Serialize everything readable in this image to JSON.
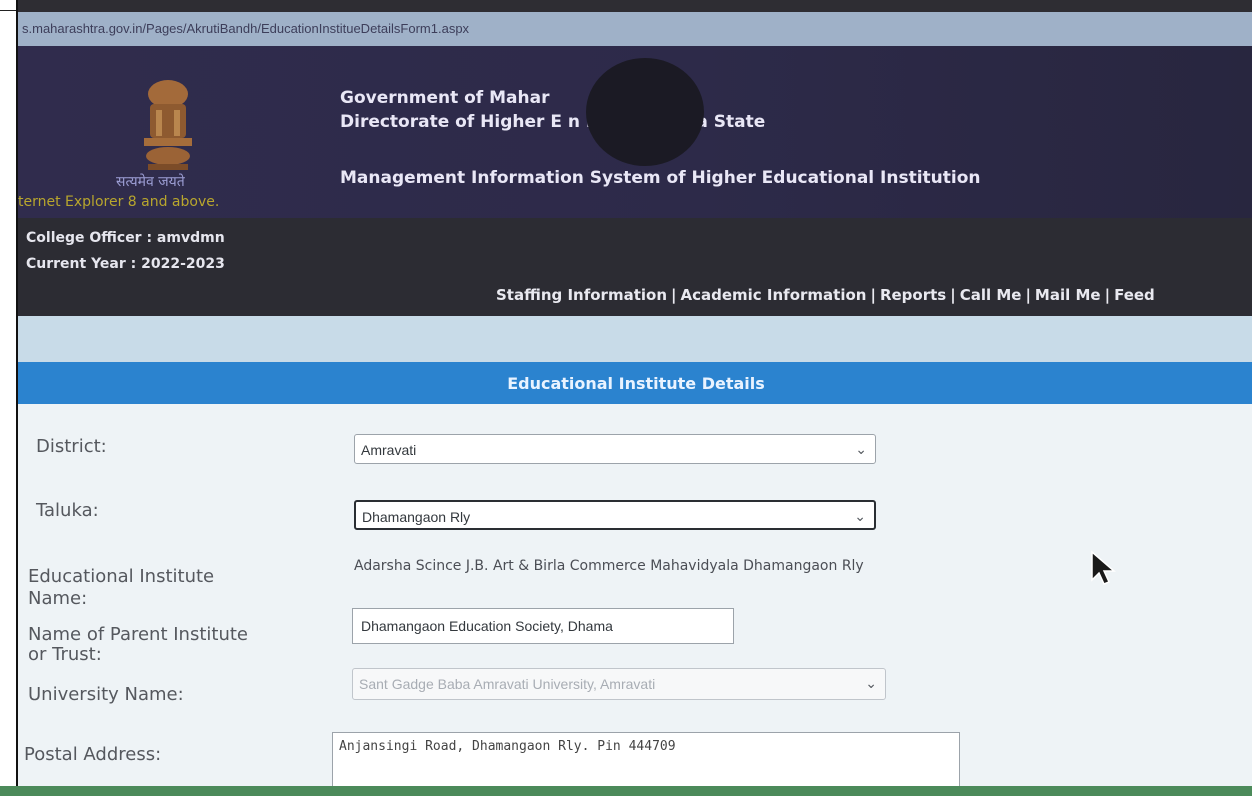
{
  "browser": {
    "address_text": "s.maharashtra.gov.in/Pages/AkrutiBandh/EducationInstitueDetailsForm1.aspx"
  },
  "header": {
    "motto": "सत्यमेव जयते",
    "ie_note": "ternet Explorer 8 and above.",
    "title_line1": "Government of Mahar",
    "title_line2": "Directorate of Higher E        n Maharashtra State",
    "title_line3": "Management Information System of Higher Educational Institution",
    "emblem_icon": "national-emblem-icon"
  },
  "user": {
    "officer": "College Officer : amvdmn",
    "year": "Current Year : 2022-2023"
  },
  "nav": {
    "items": [
      "Staffing Information",
      "Academic Information",
      "Reports",
      "Call Me",
      "Mail Me",
      "Feed"
    ],
    "separator": "|"
  },
  "section": {
    "title": "Educational Institute Details"
  },
  "form": {
    "district_label": "District:",
    "district_value": "Amravati",
    "taluka_label": "Taluka:",
    "taluka_value": "Dhamangaon Rly",
    "institute_label_line1": "Educational Institute",
    "institute_label_line2": "Name:",
    "institute_value": "Adarsha Scince J.B. Art & Birla Commerce Mahavidyala Dhamangaon Rly",
    "parent_label_line1": "Name of Parent Institute",
    "parent_label_line2": "or Trust:",
    "parent_value": "Dhamangaon Education Society, Dhama",
    "university_label": "University Name:",
    "university_value": "Sant Gadge Baba Amravati University, Amravati",
    "postal_label": "Postal Address:",
    "postal_value": "Anjansingi Road, Dhamangaon Rly. Pin 444709"
  },
  "colors": {
    "banner": "#2d2a49",
    "section_bar": "#2b83cf",
    "form_bg": "#eef3f6"
  }
}
